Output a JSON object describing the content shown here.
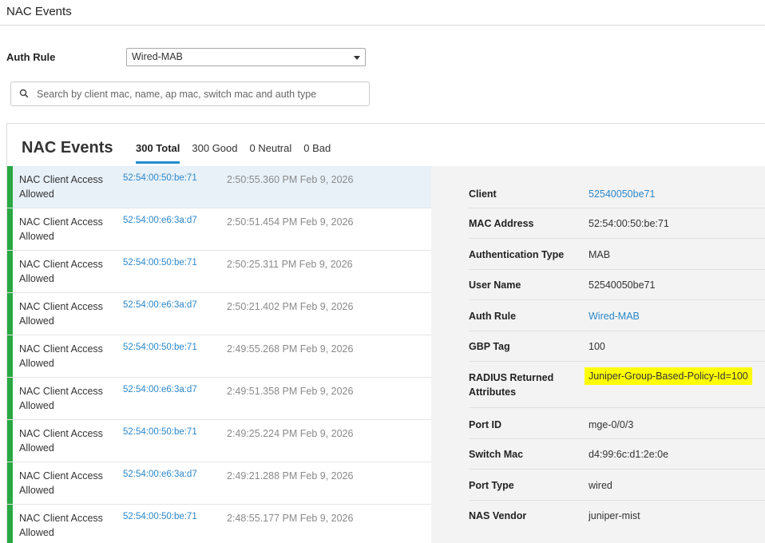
{
  "page": {
    "title": "NAC Events"
  },
  "filter": {
    "auth_rule_label": "Auth Rule",
    "auth_rule_value": "Wired-MAB",
    "search_placeholder": "Search by client mac, name, ap mac, switch mac and auth type"
  },
  "panel": {
    "title": "NAC Events",
    "tabs": [
      {
        "label": "300 Total"
      },
      {
        "label": "300 Good"
      },
      {
        "label": "0 Neutral"
      },
      {
        "label": "0 Bad"
      }
    ]
  },
  "events": [
    {
      "text": "NAC Client Access Allowed",
      "mac": "52:54:00:50:be:71",
      "time": "2:50:55.360 PM Feb 9, 2026"
    },
    {
      "text": "NAC Client Access Allowed",
      "mac": "52:54:00:e6:3a:d7",
      "time": "2:50:51.454 PM Feb 9, 2026"
    },
    {
      "text": "NAC Client Access Allowed",
      "mac": "52:54:00:50:be:71",
      "time": "2:50:25.311 PM Feb 9, 2026"
    },
    {
      "text": "NAC Client Access Allowed",
      "mac": "52:54:00:e6:3a:d7",
      "time": "2:50:21.402 PM Feb 9, 2026"
    },
    {
      "text": "NAC Client Access Allowed",
      "mac": "52:54:00:50:be:71",
      "time": "2:49:55.268 PM Feb 9, 2026"
    },
    {
      "text": "NAC Client Access Allowed",
      "mac": "52:54:00:e6:3a:d7",
      "time": "2:49:51.358 PM Feb 9, 2026"
    },
    {
      "text": "NAC Client Access Allowed",
      "mac": "52:54:00:50:be:71",
      "time": "2:49:25.224 PM Feb 9, 2026"
    },
    {
      "text": "NAC Client Access Allowed",
      "mac": "52:54:00:e6:3a:d7",
      "time": "2:49:21.288 PM Feb 9, 2026"
    },
    {
      "text": "NAC Client Access Allowed",
      "mac": "52:54:00:50:be:71",
      "time": "2:48:55.177 PM Feb 9, 2026"
    }
  ],
  "details": [
    {
      "label": "Client",
      "value": "52540050be71",
      "style": "link"
    },
    {
      "label": "MAC Address",
      "value": "52:54:00:50:be:71",
      "style": ""
    },
    {
      "label": "Authentication Type",
      "value": "MAB",
      "style": ""
    },
    {
      "label": "User Name",
      "value": "52540050be71",
      "style": ""
    },
    {
      "label": "Auth Rule",
      "value": "Wired-MAB",
      "style": "link"
    },
    {
      "label": "GBP Tag",
      "value": "100",
      "style": ""
    },
    {
      "label": "RADIUS Returned Attributes",
      "value": "Juniper-Group-Based-Policy-Id=100",
      "style": "highlight"
    },
    {
      "label": "Port ID",
      "value": "mge-0/0/3",
      "style": ""
    },
    {
      "label": "Switch Mac",
      "value": "d4:99:6c:d1:2e:0e",
      "style": ""
    },
    {
      "label": "Port Type",
      "value": "wired",
      "style": ""
    },
    {
      "label": "NAS Vendor",
      "value": "juniper-mist",
      "style": ""
    }
  ],
  "colors": {
    "good": "#29a844",
    "link": "#2b87c9",
    "accent": "#1f8ecf",
    "highlight": "#ffff00"
  }
}
